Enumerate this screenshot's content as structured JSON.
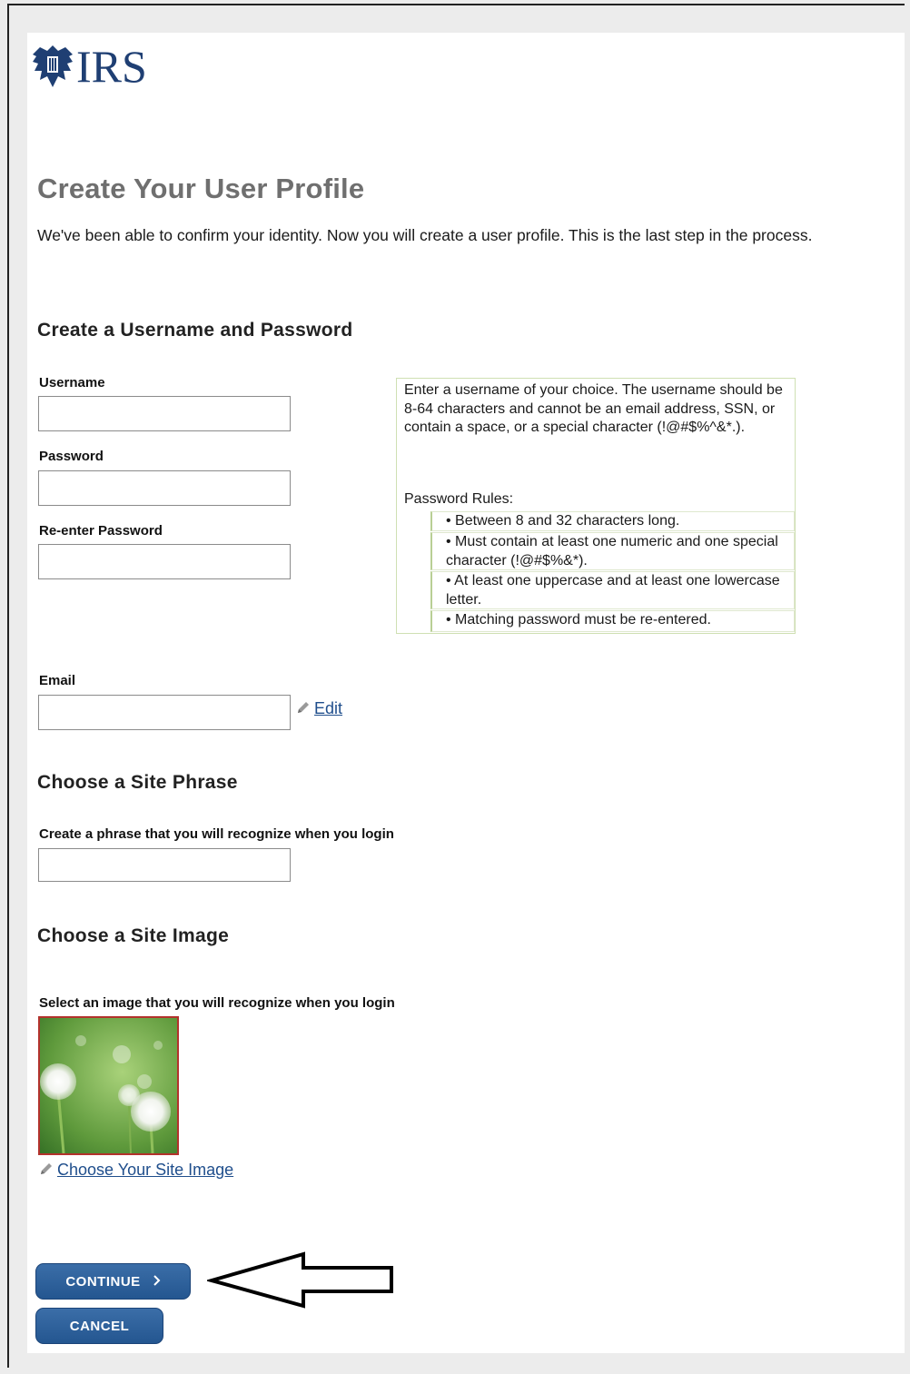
{
  "header": {
    "logo_text": "IRS"
  },
  "page": {
    "title": "Create Your User Profile",
    "intro": "We've been able to confirm your identity. Now you will create a user profile. This is the last step in the process."
  },
  "credentials": {
    "heading": "Create a Username and Password",
    "username_label": "Username",
    "username_value": "",
    "password_label": "Password",
    "password_value": "",
    "reenter_label": "Re-enter Password",
    "reenter_value": ""
  },
  "help": {
    "username_hint": "Enter a username of your choice. The username should be 8-64 characters and cannot be an email address, SSN, or contain a space, or a special character (!@#$%^&*.).",
    "password_rules_title": "Password Rules:",
    "password_rules": [
      "• Between 8 and 32 characters long.",
      "• Must contain at least one numeric and one special character (!@#$%&*).",
      "• At least one uppercase and at least one lowercase letter.",
      "• Matching password must be re-entered."
    ]
  },
  "email": {
    "label": "Email",
    "value": "",
    "edit_label": "Edit",
    "edit_icon": "pencil-icon"
  },
  "site_phrase": {
    "heading": "Choose a Site Phrase",
    "label": "Create a phrase that you will recognize when you login",
    "value": ""
  },
  "site_image": {
    "heading": "Choose a Site Image",
    "label": "Select an image that you will recognize when you login",
    "choose_label": "Choose Your Site Image",
    "choose_icon": "pencil-icon"
  },
  "actions": {
    "continue_label": "CONTINUE",
    "continue_icon": "chevron-right-icon",
    "cancel_label": "CANCEL",
    "annotation_icon": "left-arrow-icon"
  },
  "colors": {
    "button": "#2d5f9a",
    "link": "#1f4e8c",
    "title_gray": "#6f6f6f",
    "image_border": "#b3322c"
  }
}
